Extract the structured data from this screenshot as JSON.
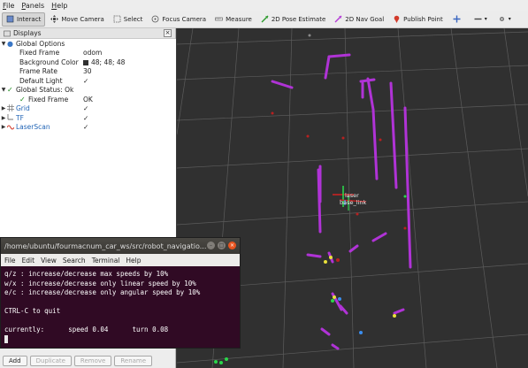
{
  "menubar": {
    "items": [
      "File",
      "Panels",
      "Help"
    ]
  },
  "toolbar": {
    "tools": [
      {
        "label": "Interact",
        "icon": "interact-icon",
        "active": true
      },
      {
        "label": "Move Camera",
        "icon": "move-camera-icon"
      },
      {
        "label": "Select",
        "icon": "select-icon"
      },
      {
        "label": "Focus Camera",
        "icon": "focus-camera-icon"
      },
      {
        "label": "Measure",
        "icon": "measure-icon"
      },
      {
        "label": "2D Pose Estimate",
        "icon": "pose-estimate-icon"
      },
      {
        "label": "2D Nav Goal",
        "icon": "nav-goal-icon"
      },
      {
        "label": "Publish Point",
        "icon": "publish-point-icon"
      }
    ]
  },
  "displays": {
    "title": "Displays",
    "global_options": {
      "label": "Global Options",
      "fixed_frame_label": "Fixed Frame",
      "fixed_frame_value": "odom",
      "background_color_label": "Background Color",
      "background_color_value": "48; 48; 48",
      "frame_rate_label": "Frame Rate",
      "frame_rate_value": "30",
      "default_light_label": "Default Light",
      "default_light_value": "✓"
    },
    "global_status": {
      "label": "Global Status: Ok",
      "fixed_frame_label": "Fixed Frame",
      "fixed_frame_value": "OK"
    },
    "grid": {
      "label": "Grid",
      "value": "✓"
    },
    "tf": {
      "label": "TF",
      "value": "✓"
    },
    "laserscan": {
      "label": "LaserScan",
      "value": "✓"
    },
    "buttons": {
      "add": "Add",
      "duplicate": "Duplicate",
      "remove": "Remove",
      "rename": "Rename"
    }
  },
  "view": {
    "background_color": "#303030",
    "tf_labels": {
      "laser": "laser",
      "base_link": "base_link"
    }
  },
  "terminal": {
    "title": "/home/ubuntu/fourmacnum_car_ws/src/robot_navigatio...",
    "menu": [
      "File",
      "Edit",
      "View",
      "Search",
      "Terminal",
      "Help"
    ],
    "lines": [
      "q/z : increase/decrease max speeds by 10%",
      "w/x : increase/decrease only linear speed by 10%",
      "e/c : increase/decrease only angular speed by 10%",
      "",
      "CTRL-C to quit",
      "",
      "currently:      speed 0.04      turn 0.08"
    ]
  },
  "colors": {
    "scan": "#b033d6",
    "terminal_bg": "#300a24",
    "accent": "#e9541f"
  }
}
